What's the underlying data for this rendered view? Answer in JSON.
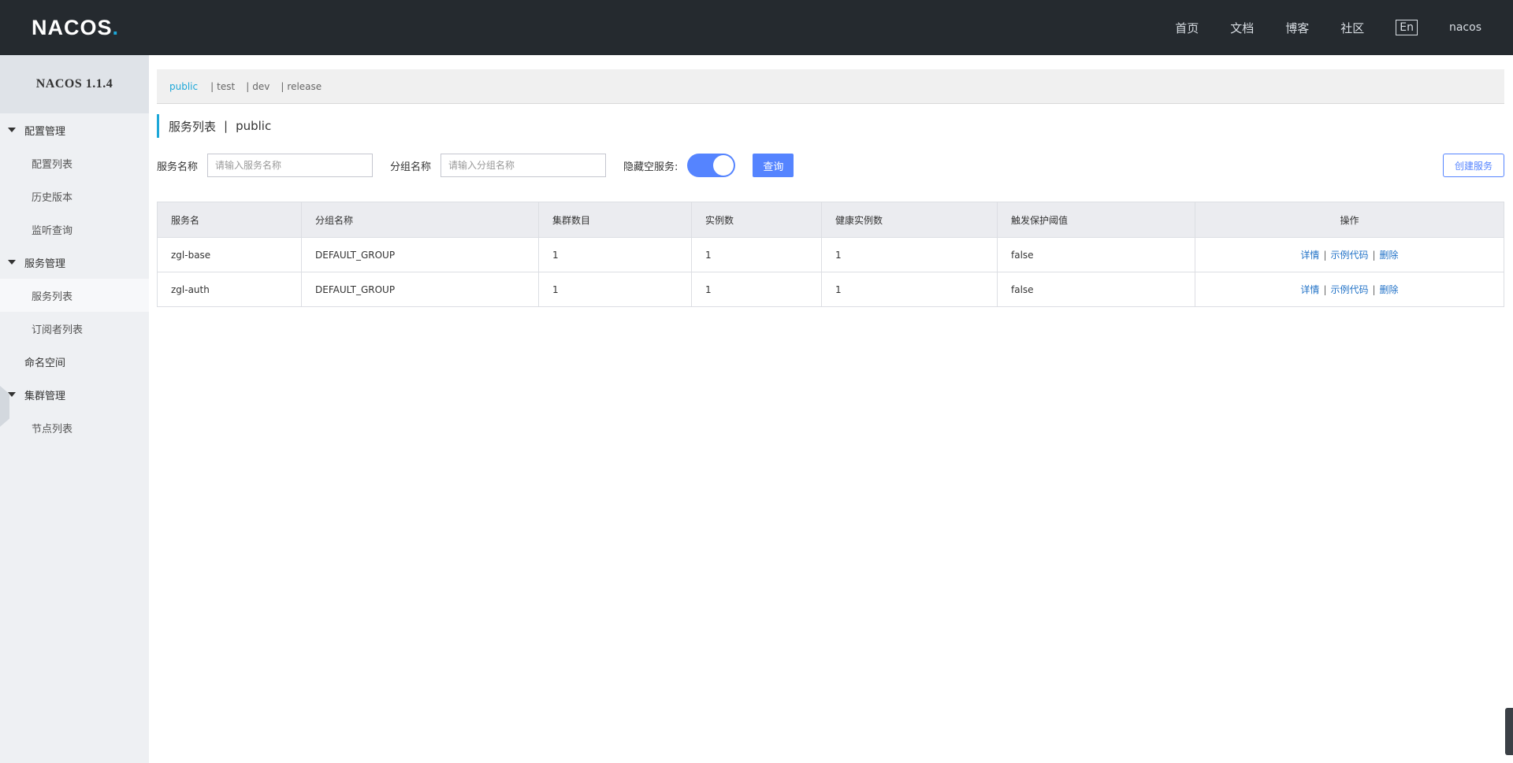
{
  "header": {
    "logo_text": "NACOS",
    "logo_dot": ".",
    "nav": [
      "首页",
      "文档",
      "博客",
      "社区"
    ],
    "lang": "En",
    "user": "nacos"
  },
  "sidebar": {
    "version": "NACOS 1.1.4",
    "groups": [
      {
        "label": "配置管理",
        "items": [
          "配置列表",
          "历史版本",
          "监听查询"
        ]
      },
      {
        "label": "服务管理",
        "items": [
          "服务列表",
          "订阅者列表"
        ]
      },
      {
        "label": "命名空间"
      },
      {
        "label": "集群管理",
        "items": [
          "节点列表"
        ]
      }
    ]
  },
  "namespaces": {
    "active": "public",
    "others": [
      "test",
      "dev",
      "release"
    ],
    "separator": "|"
  },
  "title": {
    "text": "服务列表",
    "separator": "|",
    "namespace": "public"
  },
  "filters": {
    "service_name_label": "服务名称",
    "service_name_placeholder": "请输入服务名称",
    "group_name_label": "分组名称",
    "group_name_placeholder": "请输入分组名称",
    "hide_empty_label": "隐藏空服务:",
    "hide_empty_on": true,
    "query_button": "查询",
    "create_button": "创建服务"
  },
  "table": {
    "columns": [
      "服务名",
      "分组名称",
      "集群数目",
      "实例数",
      "健康实例数",
      "触发保护阈值",
      "操作"
    ],
    "rows": [
      {
        "name": "zgl-base",
        "group": "DEFAULT_GROUP",
        "clusters": "1",
        "instances": "1",
        "healthy": "1",
        "threshold": "false"
      },
      {
        "name": "zgl-auth",
        "group": "DEFAULT_GROUP",
        "clusters": "1",
        "instances": "1",
        "healthy": "1",
        "threshold": "false"
      }
    ],
    "actions": {
      "detail": "详情",
      "sample": "示例代码",
      "delete": "删除",
      "sep": "|"
    }
  }
}
